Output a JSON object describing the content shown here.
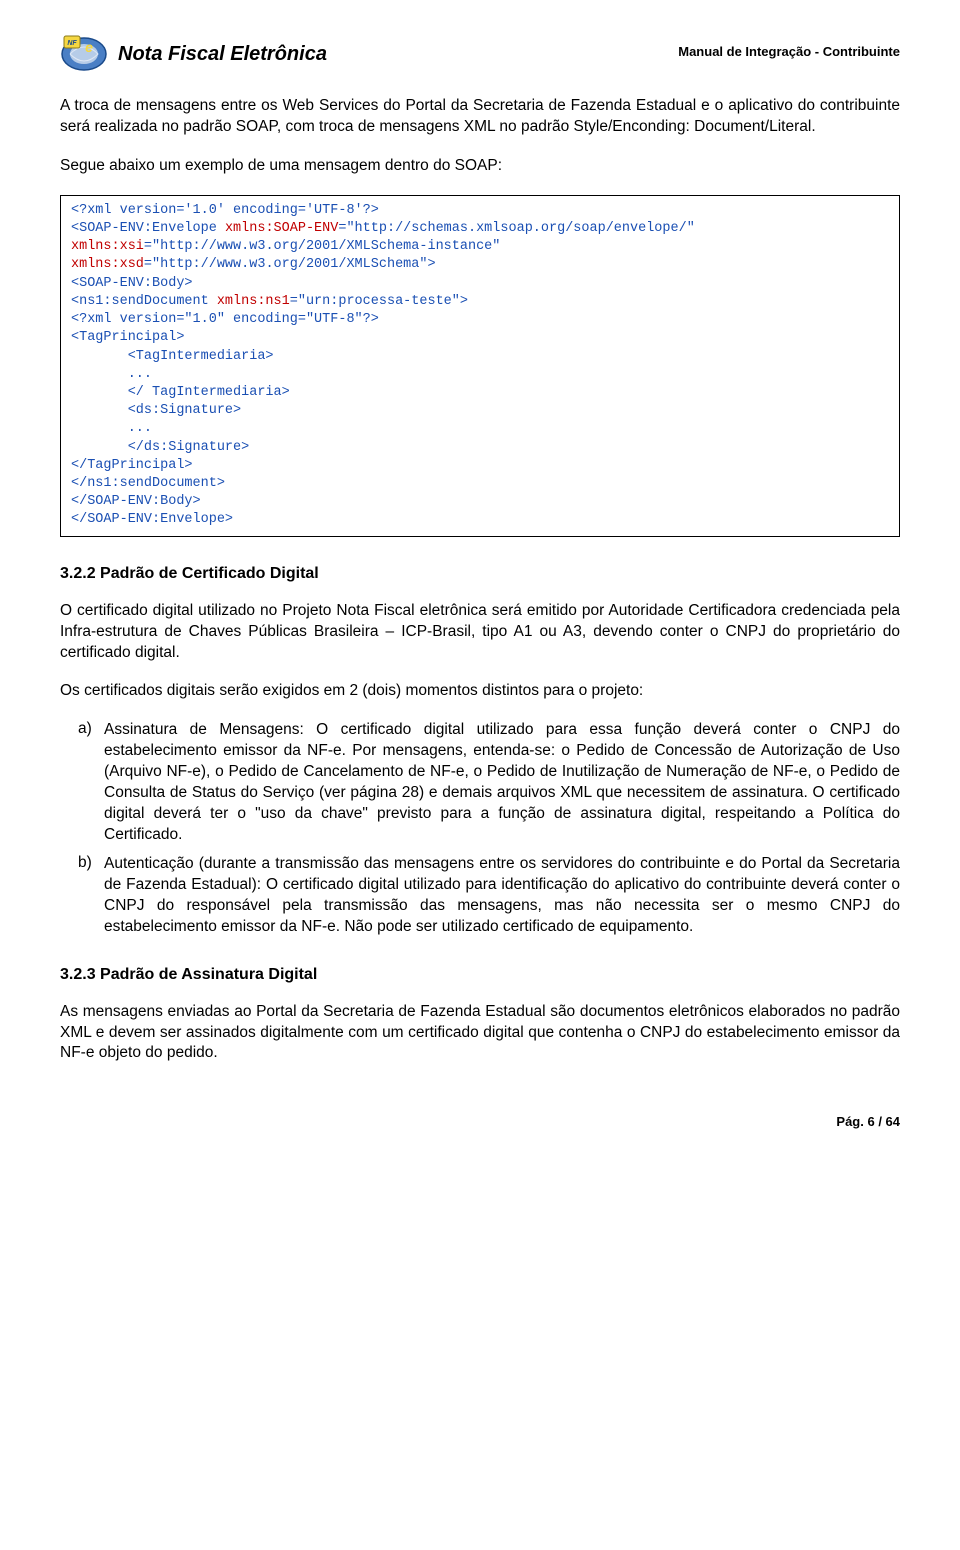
{
  "header": {
    "title": "Nota Fiscal Eletrônica",
    "logo_alt": "NF-e logo",
    "subtitle": "Manual de Integração - Contribuinte"
  },
  "intro1": "A troca de mensagens entre os Web Services do Portal da Secretaria de Fazenda Estadual e o aplicativo do contribuinte será realizada no padrão SOAP, com troca de mensagens XML no padrão Style/Enconding: Document/Literal.",
  "intro2": "Segue abaixo um exemplo de uma mensagem dentro do SOAP:",
  "code": {
    "l1": "<?xml version='1.0' encoding='UTF-8'?>",
    "l2a": "<SOAP-ENV:Envelope ",
    "l2b": "xmlns:SOAP-ENV",
    "l2c": "=\"http://schemas.xmlsoap.org/soap/envelope/\"",
    "l3a": "xmlns:xsi",
    "l3b": "=\"http://www.w3.org/2001/XMLSchema-instance\"",
    "l4a": "xmlns:xsd",
    "l4b": "=\"http://www.w3.org/2001/XMLSchema\">",
    "l5": "<SOAP-ENV:Body>",
    "l6a": "<ns1:sendDocument ",
    "l6b": "xmlns:ns1",
    "l6c": "=\"urn:processa-teste\">",
    "l7": "<?xml version=\"1.0\" encoding=\"UTF-8\"?>",
    "l8": "<TagPrincipal>",
    "l9": "       <TagIntermediaria>",
    "l10": "       ...",
    "l11": "       </ TagIntermediaria>",
    "l12": "       <ds:Signature>",
    "l13": "       ...",
    "l14": "       </ds:Signature>",
    "l15": "</TagPrincipal>",
    "l16": "</ns1:sendDocument>",
    "l17": "</SOAP-ENV:Body>",
    "l18": "</SOAP-ENV:Envelope>"
  },
  "sec322": {
    "title": "3.2.2  Padrão de Certificado Digital",
    "p1": "O certificado digital utilizado no Projeto Nota Fiscal eletrônica será emitido por Autoridade Certificadora credenciada pela Infra-estrutura de Chaves Públicas Brasileira – ICP-Brasil, tipo A1 ou A3, devendo conter o CNPJ do proprietário do certificado digital.",
    "p2": "Os certificados digitais serão exigidos em 2 (dois) momentos distintos para o projeto:",
    "a_marker": "a)",
    "a_text": "Assinatura de Mensagens: O certificado digital utilizado para essa função deverá conter o CNPJ do estabelecimento emissor da NF-e. Por mensagens, entenda-se: o Pedido de Concessão de Autorização de Uso (Arquivo NF-e), o Pedido de Cancelamento de NF-e, o Pedido de Inutilização de Numeração de NF-e, o Pedido de Consulta de Status do Serviço (ver página 28) e demais arquivos XML que necessitem de assinatura. O certificado digital deverá ter o \"uso da chave\" previsto para a função de assinatura digital, respeitando a Política do Certificado.",
    "b_marker": "b)",
    "b_text": "Autenticação (durante a transmissão das mensagens entre os servidores do contribuinte e do Portal da Secretaria de Fazenda Estadual): O certificado digital utilizado para identificação do aplicativo do contribuinte deverá conter o CNPJ do responsável pela transmissão das mensagens, mas não necessita ser o mesmo CNPJ do estabelecimento emissor da NF-e. Não pode ser utilizado certificado de equipamento."
  },
  "sec323": {
    "title": "3.2.3  Padrão de Assinatura Digital",
    "p1": "As mensagens enviadas ao Portal da Secretaria de Fazenda Estadual são documentos eletrônicos elaborados no padrão XML e devem ser assinados digitalmente com um certificado digital que contenha o CNPJ do estabelecimento emissor da NF-e objeto do pedido."
  },
  "footer": "Pág. 6 / 64"
}
